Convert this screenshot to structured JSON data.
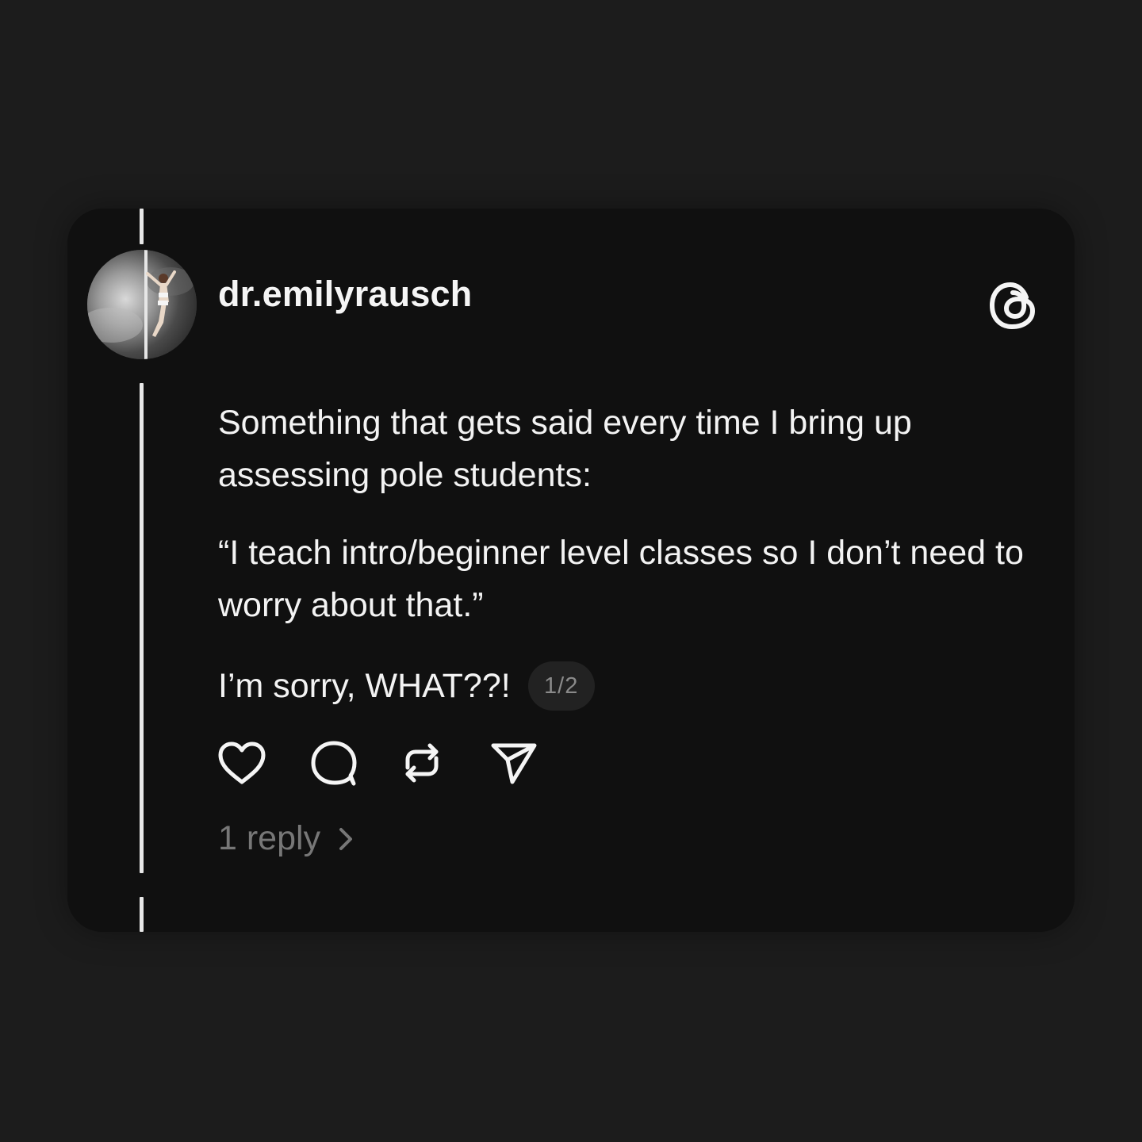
{
  "post": {
    "username": "dr.emilyrausch",
    "paragraphs": [
      "Something that gets said every time I bring up assessing pole students:",
      "“I teach intro/beginner level classes so I don’t need to worry about that.”",
      "I’m sorry, WHAT??!"
    ],
    "page_indicator": "1/2",
    "replies_label": "1 reply"
  },
  "icons": {
    "logo": "threads-logo-icon",
    "like": "heart-icon",
    "reply": "comment-icon",
    "repost": "repost-icon",
    "share": "send-icon",
    "chevron": "chevron-right-icon"
  },
  "colors": {
    "background": "#1c1c1c",
    "card": "#101010",
    "text": "#f3f3f3",
    "muted": "#777777",
    "badge": "#222222"
  }
}
